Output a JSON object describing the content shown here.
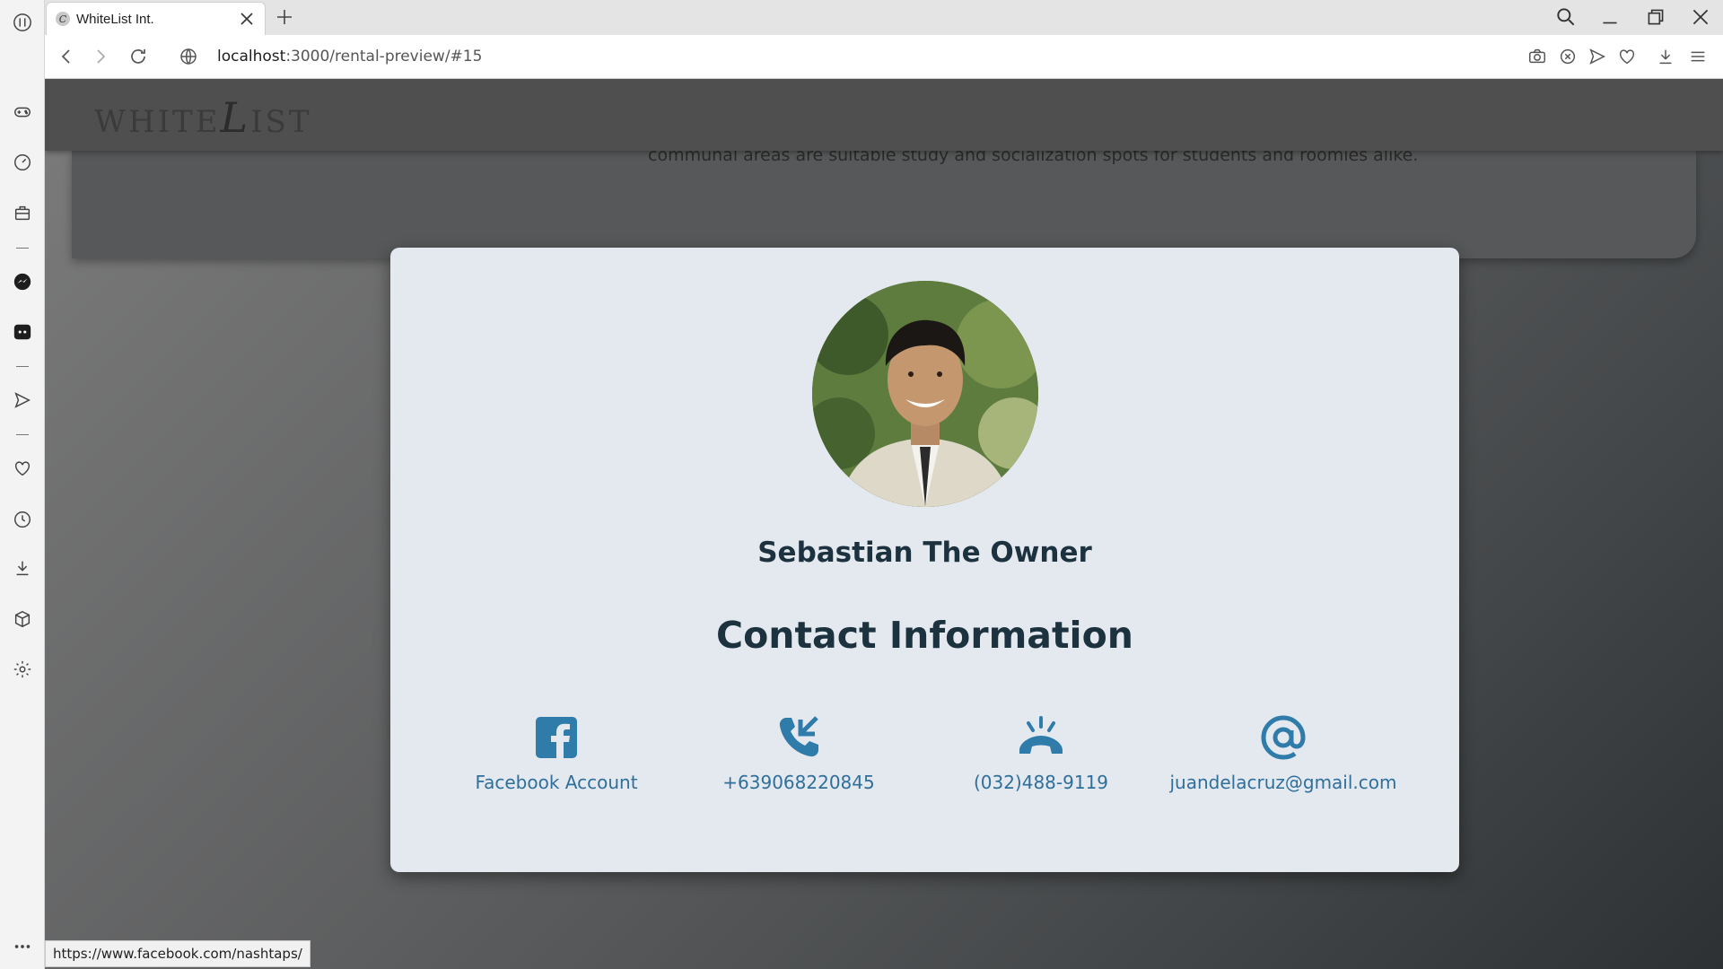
{
  "browser": {
    "tab_title": "WhiteList Int.",
    "favicon_letter": "C",
    "url_host": "localhost",
    "url_rest": ":3000/rental-preview/#15",
    "status_url": "https://www.facebook.com/nashtaps/"
  },
  "site": {
    "logo_prefix": "WHITE",
    "logo_big": "L",
    "logo_suffix": "IST",
    "background_text": "communal areas are suitable study and socialization spots for students and roomies alike."
  },
  "modal": {
    "owner_name": "Sebastian The Owner",
    "contact_title": "Contact Information",
    "contacts": [
      {
        "icon": "facebook-icon",
        "label": "Facebook Account"
      },
      {
        "icon": "phone-call-icon",
        "label": "+639068220845"
      },
      {
        "icon": "telephone-ringing-icon",
        "label": "(032)488-9119"
      },
      {
        "icon": "at-sign-icon",
        "label": "juandelacruz@gmail.com"
      }
    ]
  },
  "colors": {
    "accent": "#2f7cab",
    "heading": "#1d323f",
    "modal_bg": "#e4e8ef"
  }
}
